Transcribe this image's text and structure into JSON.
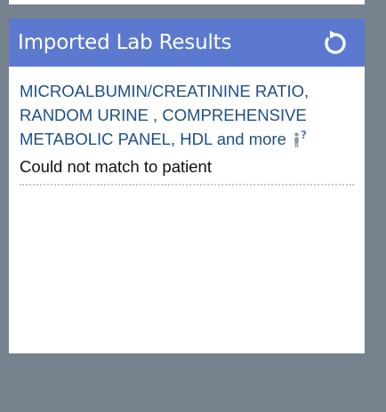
{
  "panel": {
    "title": "Imported Lab Results",
    "refresh_icon": "refresh-icon"
  },
  "results": [
    {
      "tests": "MICROALBUMIN/CREATININE RATIO, RANDOM URINE , COMPREHENSIVE METABOLIC PANEL, HDL",
      "more_label": "and more",
      "match_icon": "person-question-icon",
      "status": "Could not match to patient"
    }
  ],
  "colors": {
    "header": "#5b79cf",
    "link": "#1d4f86",
    "background": "#76838f"
  }
}
